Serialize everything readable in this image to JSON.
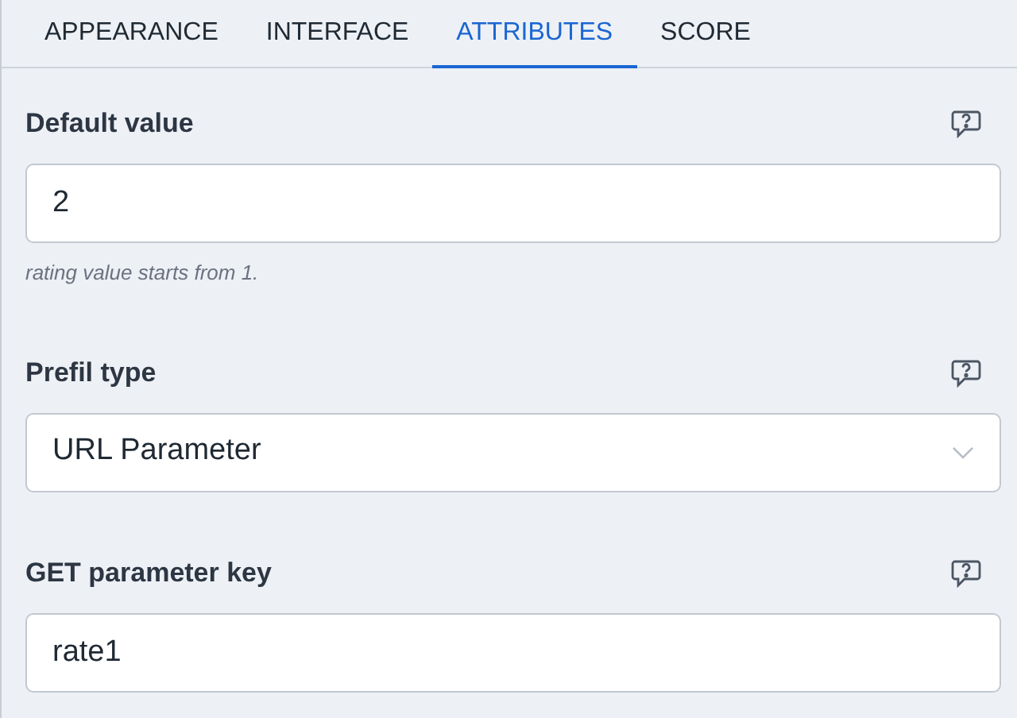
{
  "tabs": [
    {
      "label": "APPEARANCE",
      "selected": false
    },
    {
      "label": "INTERFACE",
      "selected": false
    },
    {
      "label": "ATTRIBUTES",
      "selected": true
    },
    {
      "label": "SCORE",
      "selected": false
    }
  ],
  "fields": [
    {
      "kind": "input",
      "label": "Default value",
      "value": "2",
      "hint": "rating value starts from 1."
    },
    {
      "kind": "select",
      "label": "Prefil type",
      "value": "URL Parameter"
    },
    {
      "kind": "input",
      "label": "GET parameter key",
      "value": "rate1"
    }
  ]
}
